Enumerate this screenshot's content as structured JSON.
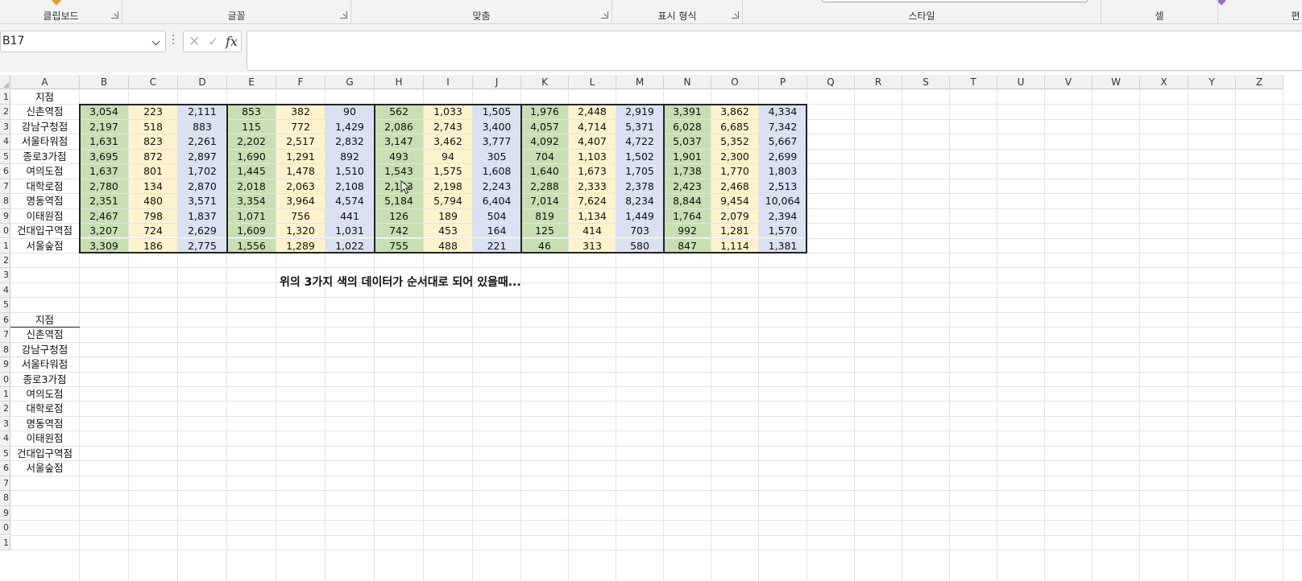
{
  "ribbon": {
    "groups": [
      {
        "label": "클립보드"
      },
      {
        "label": "글꼴"
      },
      {
        "label": "맞춤"
      },
      {
        "label": "표시 형식"
      },
      {
        "label": "스타일"
      },
      {
        "label": "셀"
      },
      {
        "label": "편"
      }
    ]
  },
  "formula_bar": {
    "name_box": "B17",
    "formula": ""
  },
  "columns": [
    "A",
    "B",
    "C",
    "D",
    "E",
    "F",
    "G",
    "H",
    "I",
    "J",
    "K",
    "L",
    "M",
    "N",
    "O",
    "P",
    "Q",
    "R",
    "S",
    "T",
    "U",
    "V",
    "W",
    "X",
    "Y",
    "Z"
  ],
  "rows": [
    "1",
    "2",
    "3",
    "4",
    "5",
    "6",
    "7",
    "8",
    "9",
    "0",
    "1",
    "2",
    "3",
    "4",
    "5",
    "6",
    "7",
    "8",
    "9",
    "0",
    "1",
    "2",
    "3",
    "4",
    "5",
    "6",
    "7",
    "8",
    "9",
    "0",
    "1"
  ],
  "table_top": {
    "header": "지점",
    "stores": [
      "신촌역점",
      "강남구청점",
      "서울타워점",
      "종로3가점",
      "여의도점",
      "대학로점",
      "명동역점",
      "이태원점",
      "건대입구역점",
      "서울숲점"
    ],
    "values": [
      [
        "3,054",
        "223",
        "2,111",
        "853",
        "382",
        "90",
        "562",
        "1,033",
        "1,505",
        "1,976",
        "2,448",
        "2,919",
        "3,391",
        "3,862",
        "4,334"
      ],
      [
        "2,197",
        "518",
        "883",
        "115",
        "772",
        "1,429",
        "2,086",
        "2,743",
        "3,400",
        "4,057",
        "4,714",
        "5,371",
        "6,028",
        "6,685",
        "7,342"
      ],
      [
        "1,631",
        "823",
        "2,261",
        "2,202",
        "2,517",
        "2,832",
        "3,147",
        "3,462",
        "3,777",
        "4,092",
        "4,407",
        "4,722",
        "5,037",
        "5,352",
        "5,667"
      ],
      [
        "3,695",
        "872",
        "2,897",
        "1,690",
        "1,291",
        "892",
        "493",
        "94",
        "305",
        "704",
        "1,103",
        "1,502",
        "1,901",
        "2,300",
        "2,699"
      ],
      [
        "1,637",
        "801",
        "1,702",
        "1,445",
        "1,478",
        "1,510",
        "1,543",
        "1,575",
        "1,608",
        "1,640",
        "1,673",
        "1,705",
        "1,738",
        "1,770",
        "1,803"
      ],
      [
        "2,780",
        "134",
        "2,870",
        "2,018",
        "2,063",
        "2,108",
        "2,153",
        "2,198",
        "2,243",
        "2,288",
        "2,333",
        "2,378",
        "2,423",
        "2,468",
        "2,513"
      ],
      [
        "2,351",
        "480",
        "3,571",
        "3,354",
        "3,964",
        "4,574",
        "5,184",
        "5,794",
        "6,404",
        "7,014",
        "7,624",
        "8,234",
        "8,844",
        "9,454",
        "10,064"
      ],
      [
        "2,467",
        "798",
        "1,837",
        "1,071",
        "756",
        "441",
        "126",
        "189",
        "504",
        "819",
        "1,134",
        "1,449",
        "1,764",
        "2,079",
        "2,394"
      ],
      [
        "3,207",
        "724",
        "2,629",
        "1,609",
        "1,320",
        "1,031",
        "742",
        "453",
        "164",
        "125",
        "414",
        "703",
        "992",
        "1,281",
        "1,570"
      ],
      [
        "3,309",
        "186",
        "2,775",
        "1,556",
        "1,289",
        "1,022",
        "755",
        "488",
        "221",
        "46",
        "313",
        "580",
        "847",
        "1,114",
        "1,381"
      ]
    ],
    "colors": {
      "green": "#c6e0b4",
      "yellow": "#fff2cc",
      "blue": "#d9e1f2"
    }
  },
  "note": "위의 3가지 색의 데이터가 순서대로 되어 있을때...",
  "table_bottom": {
    "header": "지점",
    "stores": [
      "신촌역점",
      "강남구청점",
      "서울타워점",
      "종로3가점",
      "여의도점",
      "대학로점",
      "명동역점",
      "이태원점",
      "건대입구역점",
      "서울숲점"
    ]
  }
}
